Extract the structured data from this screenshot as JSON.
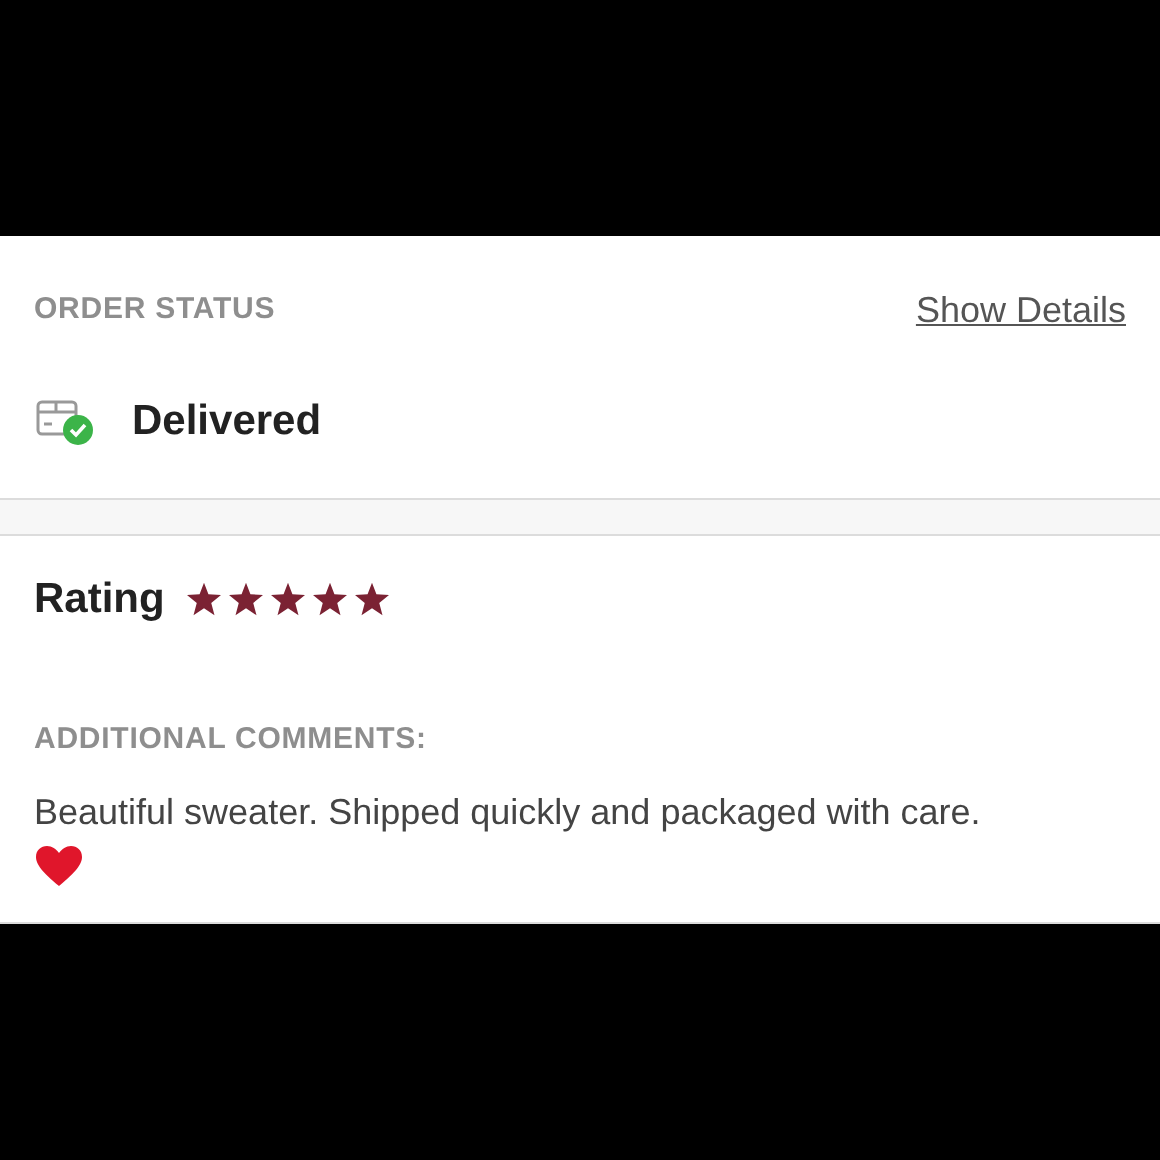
{
  "order_status": {
    "heading": "ORDER STATUS",
    "link": "Show Details",
    "status": "Delivered"
  },
  "review": {
    "label": "Rating",
    "stars": 5,
    "comments_heading": "ADDITIONAL COMMENTS:",
    "comment": "Beautiful sweater. Shipped quickly and packaged with care."
  }
}
